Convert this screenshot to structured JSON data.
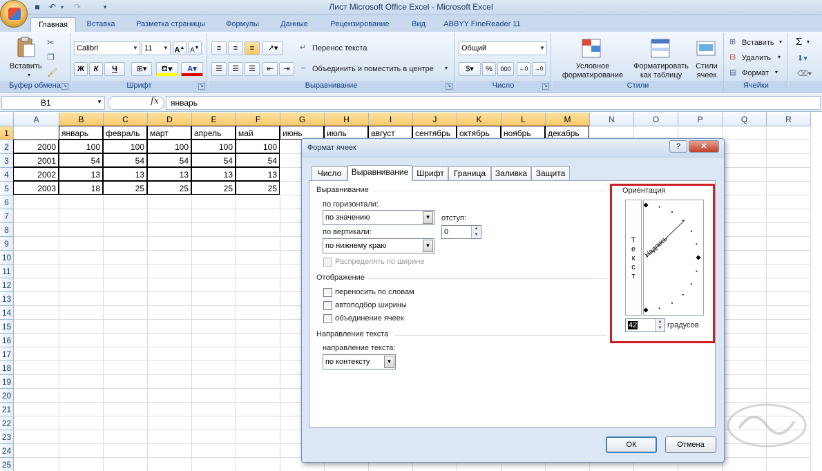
{
  "window": {
    "title": "Лист Microsoft Office Excel - Microsoft Excel"
  },
  "ribbon_tabs": [
    "Главная",
    "Вставка",
    "Разметка страницы",
    "Формулы",
    "Данные",
    "Рецензирование",
    "Вид",
    "ABBYY FineReader 11"
  ],
  "ribbon": {
    "clipboard": {
      "paste_label": "Вставить",
      "group_label": "Буфер обмена"
    },
    "font": {
      "font_name": "Calibri",
      "font_size": "11",
      "bold": "Ж",
      "italic": "К",
      "underline": "Ч",
      "group_label": "Шрифт"
    },
    "alignment": {
      "wrap_text": "Перенос текста",
      "merge_center": "Объединить и поместить в центре",
      "group_label": "Выравнивание"
    },
    "number": {
      "format": "Общий",
      "percent": "%",
      "thousands": "000",
      "group_label": "Число"
    },
    "styles": {
      "conditional": "Условное форматирование",
      "as_table": "Форматировать как таблицу",
      "cell_styles": "Стили ячеек",
      "group_label": "Стили"
    },
    "cells": {
      "insert": "Вставить",
      "delete": "Удалить",
      "format": "Формат",
      "group_label": "Ячейки"
    },
    "editing": {
      "sum": "Σ"
    }
  },
  "formula_bar": {
    "name_box": "B1",
    "fx": "fx",
    "value": "январь"
  },
  "sheet": {
    "columns": [
      "A",
      "B",
      "C",
      "D",
      "E",
      "F",
      "G",
      "H",
      "I",
      "J",
      "K",
      "L",
      "M",
      "N",
      "O",
      "P",
      "Q",
      "R"
    ],
    "rows": [
      "1",
      "2",
      "3",
      "4",
      "5",
      "6",
      "7",
      "8",
      "9",
      "10",
      "11",
      "12",
      "13",
      "14",
      "15",
      "16",
      "17",
      "18",
      "19",
      "20",
      "21",
      "22",
      "23",
      "24",
      "25"
    ],
    "header_row": [
      "",
      "январь",
      "февраль",
      "март",
      "апрель",
      "май",
      "июнь",
      "июль",
      "август",
      "сентябрь",
      "октябрь",
      "ноябрь",
      "декабрь"
    ],
    "data_rows": [
      [
        "2000",
        "100",
        "100",
        "100",
        "100",
        "100"
      ],
      [
        "2001",
        "54",
        "54",
        "54",
        "54",
        "54"
      ],
      [
        "2002",
        "13",
        "13",
        "13",
        "13",
        "13"
      ],
      [
        "2003",
        "18",
        "25",
        "25",
        "25",
        "25"
      ]
    ]
  },
  "dialog": {
    "title": "Формат ячеек",
    "help": "?",
    "close": "✕",
    "tabs": [
      "Число",
      "Выравнивание",
      "Шрифт",
      "Граница",
      "Заливка",
      "Защита"
    ],
    "active_tab": "Выравнивание",
    "alignment_section": "Выравнивание",
    "horizontal_label": "по горизонтали:",
    "horizontal_value": "по значению",
    "indent_label": "отступ:",
    "indent_value": "0",
    "vertical_label": "по вертикали:",
    "vertical_value": "по нижнему краю",
    "distribute_label": "Распределять по ширине",
    "display_section": "Отображение",
    "wrap_label": "переносить по словам",
    "shrink_label": "автоподбор ширины",
    "merge_label": "объединение ячеек",
    "direction_section": "Направление текста",
    "direction_label": "направление текста:",
    "direction_value": "по контексту",
    "orientation_section": "Ориентация",
    "vertical_text": [
      "Т",
      "е",
      "к",
      "с",
      "т"
    ],
    "dial_text": "Надпись",
    "degrees_value": "42",
    "degrees_label": "градусов",
    "ok": "ОК",
    "cancel": "Отмена"
  },
  "colors": {
    "highlight": "#cc2026",
    "selected_header": "#f8c76a",
    "ribbon_text": "#15428b"
  }
}
